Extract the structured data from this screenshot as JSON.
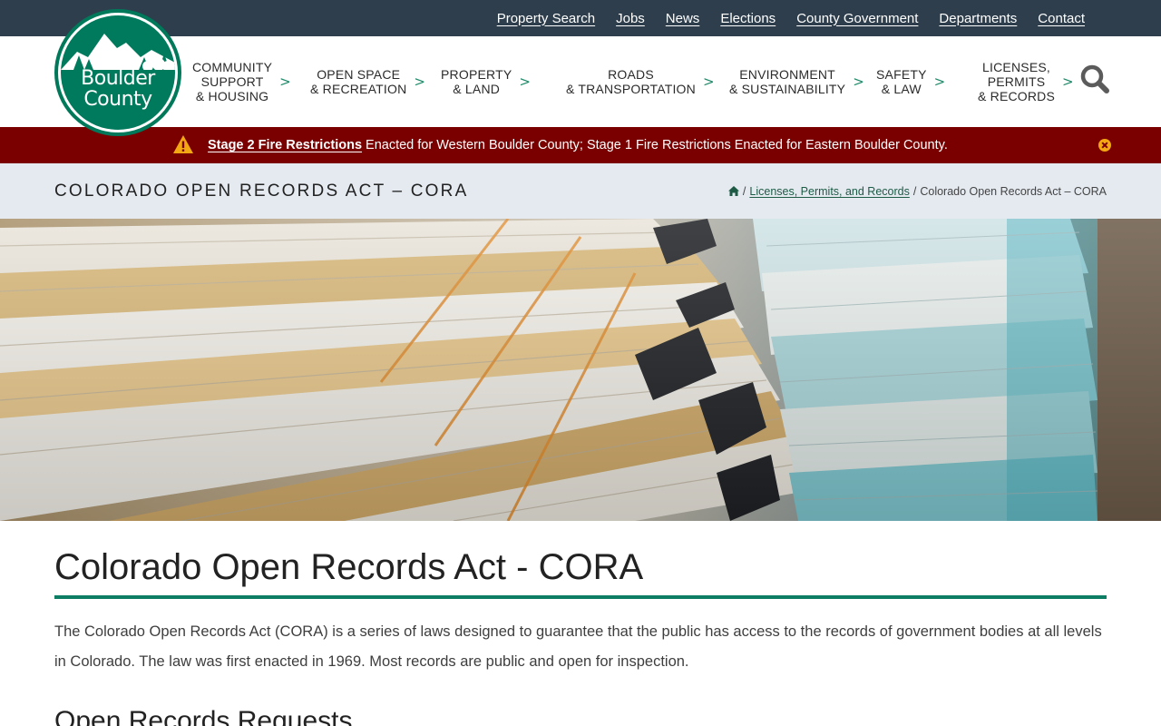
{
  "utility_nav": [
    "Property Search",
    "Jobs",
    "News",
    "Elections",
    "County Government",
    "Departments",
    "Contact"
  ],
  "logo": {
    "line1": "Boulder",
    "line2": "County"
  },
  "main_nav": [
    {
      "line1": "COMMUNITY",
      "line2": "SUPPORT",
      "line3": "& HOUSING"
    },
    {
      "line1": "OPEN SPACE",
      "line2": "& RECREATION",
      "line3": ""
    },
    {
      "line1": "PROPERTY",
      "line2": "& LAND",
      "line3": ""
    },
    {
      "line1": "ROADS",
      "line2": "& TRANSPORTATION",
      "line3": ""
    },
    {
      "line1": "ENVIRONMENT",
      "line2": "& SUSTAINABILITY",
      "line3": ""
    },
    {
      "line1": "SAFETY",
      "line2": "& LAW",
      "line3": ""
    },
    {
      "line1": "LICENSES,",
      "line2": "PERMITS",
      "line3": "& RECORDS"
    }
  ],
  "nav_chevron": ">",
  "alert": {
    "link_text": "Stage 2 Fire Restrictions",
    "text": "Enacted for Western Boulder County; Stage 1 Fire Restrictions Enacted for Eastern Boulder County."
  },
  "band": {
    "title": "COLORADO OPEN RECORDS ACT – CORA",
    "breadcrumb_sep": "/",
    "breadcrumb_link": "Licenses, Permits, and Records",
    "breadcrumb_current": "Colorado Open Records Act – CORA"
  },
  "content": {
    "title": "Colorado Open Records Act - CORA",
    "intro": "The Colorado Open Records Act (CORA) is a series of laws designed to guarantee that the public has access to the records of government bodies at all levels in Colorado. The law was first enacted in 1969. Most records are public and open for inspection.",
    "section_heading": "Open Records Requests"
  },
  "colors": {
    "utility_bar": "#2e3e4c",
    "brand_green": "#007a5c",
    "alert_red": "#7a0000",
    "alert_yellow": "#f3a712",
    "title_band": "#e4eaf0"
  },
  "icons": {
    "search": "search-icon",
    "alert": "warning-icon",
    "close": "close-icon",
    "home": "home-icon",
    "chevron": "chevron-right-icon"
  }
}
